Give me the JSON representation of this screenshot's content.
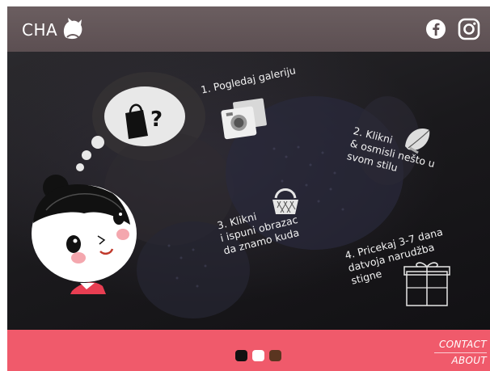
{
  "header": {
    "logo_text": "CHA",
    "social": [
      "facebook-icon",
      "instagram-icon"
    ]
  },
  "steps": [
    {
      "line1": "1. Pogledaj galeriju"
    },
    {
      "line1": "2. Klikni",
      "line2": "& osmisli nešto u",
      "line3": "svom stilu"
    },
    {
      "line1": "3. Klikni",
      "line2": "i ispuni obrazac",
      "line3": "da znamo kuda"
    },
    {
      "line1": "4. Pricekaj 3-7 dana",
      "line2": "datvoja narudžba",
      "line3": "stigne"
    }
  ],
  "footer": {
    "links": [
      "CONTACT",
      "ABOUT"
    ],
    "dots": [
      {
        "color": "#111111",
        "active": false
      },
      {
        "color": "#ffffff",
        "active": true
      },
      {
        "color": "#5a3520",
        "active": false
      }
    ]
  },
  "colors": {
    "header": "#6b5e60",
    "footer": "#f05a6b",
    "accent_cheek": "#f4a7ae"
  }
}
